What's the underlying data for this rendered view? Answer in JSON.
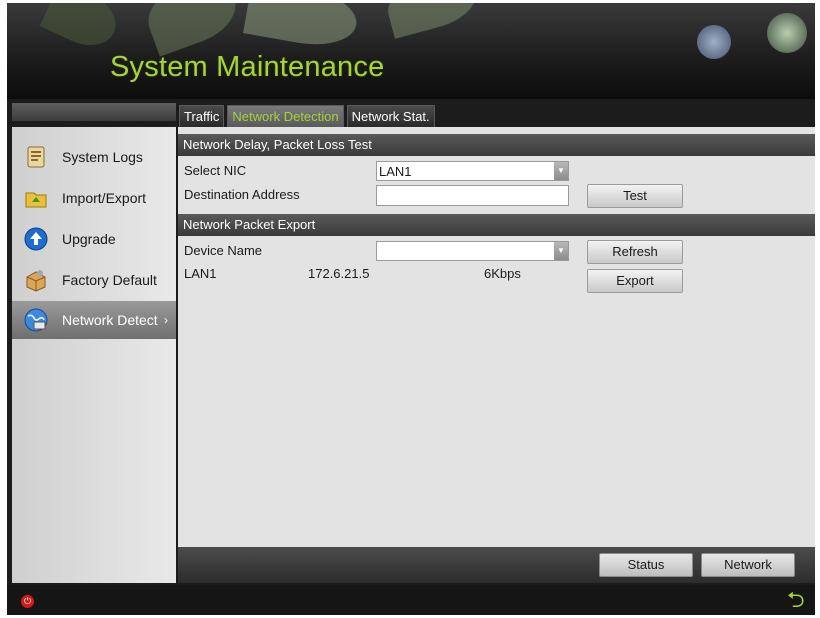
{
  "header": {
    "title": "System Maintenance"
  },
  "sidebar": {
    "items": [
      {
        "label": "System Logs",
        "icon": "notebook-icon"
      },
      {
        "label": "Import/Export",
        "icon": "folder-arrow-icon"
      },
      {
        "label": "Upgrade",
        "icon": "up-arrow-circle-icon"
      },
      {
        "label": "Factory Default",
        "icon": "box-icon"
      },
      {
        "label": "Network Detect",
        "icon": "globe-icon",
        "active": true,
        "chevron": "›"
      }
    ]
  },
  "tabs": [
    {
      "label": "Traffic"
    },
    {
      "label": "Network Detection",
      "active": true
    },
    {
      "label": "Network Stat."
    }
  ],
  "delay_test": {
    "header": "Network Delay, Packet Loss Test",
    "select_nic_label": "Select NIC",
    "select_nic_value": "LAN1",
    "destination_label": "Destination Address",
    "destination_value": "",
    "test_button": "Test"
  },
  "packet_export": {
    "header": "Network Packet Export",
    "device_name_label": "Device Name",
    "device_name_value": "",
    "refresh_button": "Refresh",
    "export_button": "Export",
    "row": {
      "nic": "LAN1",
      "ip": "172.6.21.5",
      "rate": "6Kbps"
    }
  },
  "footer": {
    "status_button": "Status",
    "network_button": "Network"
  },
  "colors": {
    "accent": "#a6d23a",
    "power": "#d21a1a"
  }
}
